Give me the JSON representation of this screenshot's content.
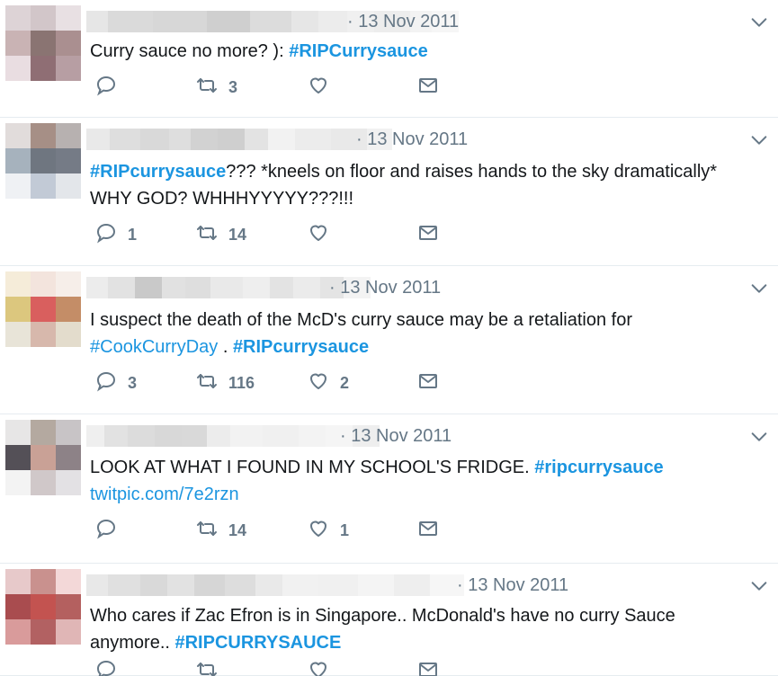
{
  "colors": {
    "link": "#1b95e0",
    "text": "#14171a",
    "muted": "#657786",
    "divider": "#e6ecf0"
  },
  "icons": {
    "reply": "reply-icon",
    "retweet": "retweet-icon",
    "like": "heart-icon",
    "dm": "envelope-icon",
    "menu": "chevron-down-icon"
  },
  "tweets": [
    {
      "date": "· 13 Nov 2011",
      "lines": [
        [
          {
            "t": "Curry sauce no more? ): ",
            "k": "plain"
          },
          {
            "t": "#RIPCurrysauce",
            "k": "tag"
          }
        ]
      ],
      "replies": "",
      "retweets": "3",
      "likes": ""
    },
    {
      "date": "· 13 Nov 2011",
      "lines": [
        [
          {
            "t": "#RIPcurrysauce",
            "k": "tag"
          },
          {
            "t": "??? *kneels on floor and raises hands to the sky dramatically*",
            "k": "plain"
          }
        ],
        [
          {
            "t": "WHY GOD? WHHHYYYYY???!!!",
            "k": "plain"
          }
        ]
      ],
      "replies": "1",
      "retweets": "14",
      "likes": ""
    },
    {
      "date": "· 13 Nov 2011",
      "lines": [
        [
          {
            "t": "I suspect the death of the McD's curry sauce may be a retaliation for",
            "k": "plain"
          }
        ],
        [
          {
            "t": "#CookCurryDay",
            "k": "link"
          },
          {
            "t": " . ",
            "k": "plain"
          },
          {
            "t": "#RIPcurrysauce",
            "k": "tag"
          }
        ]
      ],
      "replies": "3",
      "retweets": "116",
      "likes": "2"
    },
    {
      "date": "· 13 Nov 2011",
      "lines": [
        [
          {
            "t": "LOOK AT WHAT I FOUND IN MY SCHOOL'S FRIDGE. ",
            "k": "plain"
          },
          {
            "t": "#ripcurrysauce",
            "k": "tag"
          }
        ],
        [
          {
            "t": "twitpic.com/7e2rzn",
            "k": "link"
          }
        ]
      ],
      "replies": "",
      "retweets": "14",
      "likes": "1"
    },
    {
      "date": "· 13 Nov 2011",
      "lines": [
        [
          {
            "t": "Who cares if Zac Efron is in Singapore.. McDonald's have no curry Sauce",
            "k": "plain"
          }
        ],
        [
          {
            "t": "anymore.. ",
            "k": "plain"
          },
          {
            "t": "#RIPCURRYSAUCE",
            "k": "tag"
          }
        ]
      ],
      "replies": "",
      "retweets": "",
      "likes": ""
    }
  ]
}
